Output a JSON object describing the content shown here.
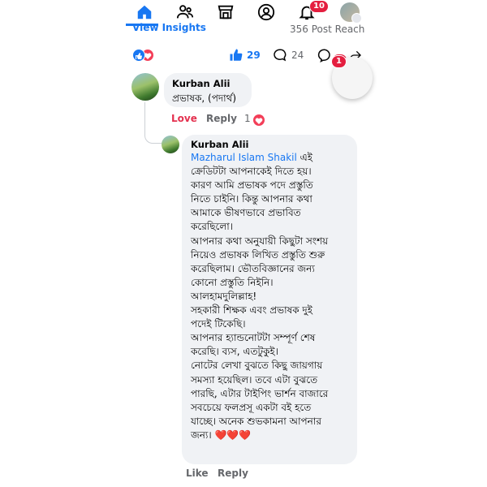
{
  "nav": {
    "items": [
      {
        "name": "home-icon",
        "active": true
      },
      {
        "name": "friends-icon"
      },
      {
        "name": "marketplace-icon"
      },
      {
        "name": "profile-icon"
      },
      {
        "name": "notifications-icon",
        "badge": "10"
      },
      {
        "name": "profile-avatar-menu-icon"
      }
    ],
    "accent": "#1877f2"
  },
  "post_bar": {
    "view_insights": "View Insights",
    "reach": "356 Post Reach"
  },
  "stats": {
    "likes": "29",
    "comments": "24",
    "messenger_badge": "1"
  },
  "comment1": {
    "author": "Kurban Alii",
    "text": "প্রভাষক, (পদার্থ)",
    "love_label": "Love",
    "reply_label": "Reply",
    "reaction_count": "1"
  },
  "reply1": {
    "author": "Kurban Alii",
    "mention": "Mazharul Islam Shakil",
    "text_start": " এই",
    "lines": [
      "ক্রেডিটটা আপনাকেই দিতে হয়।",
      "কারণ আমি প্রভাষক পদে প্রস্তুতি",
      "নিতে চাইনি। কিন্তু আপনার কথা",
      "আমাকে ভীষণভাবে প্রভাবিত",
      "করেছিলো।",
      "আপনার কথা অনুযায়ী কিছুটা সংশয়",
      "নিয়েও প্রভাষক লিখিত প্রস্তুতি শুরু",
      "করেছিলাম। ভৌতবিজ্ঞানের জন্য",
      "কোনো প্রস্তুতি নিইনি।",
      "আলহামদুলিল্লাহ!",
      "সহকারী শিক্ষক এবং প্রভাষক দুই",
      "পদেই টিকেছি।",
      "আপনার হ্যান্ডনোটটা সম্পূর্ণ শেষ",
      "করেছি। ব্যস, এতটুকুই।",
      "নোটের লেখা বুঝতে কিছু জায়গায়",
      "সমস্যা হয়েছিল।  তবে এটা বুঝতে",
      "পারছি, এটার টাইপিং ভার্শন বাজারে",
      "সবচেয়ে ফলপ্রসূ একটা বই হতে",
      "যাচ্ছে।  অনেক শুভকামনা আপনার",
      "জন্য। ❤️❤️❤️"
    ],
    "like_label": "Like",
    "reply_label": "Reply"
  }
}
